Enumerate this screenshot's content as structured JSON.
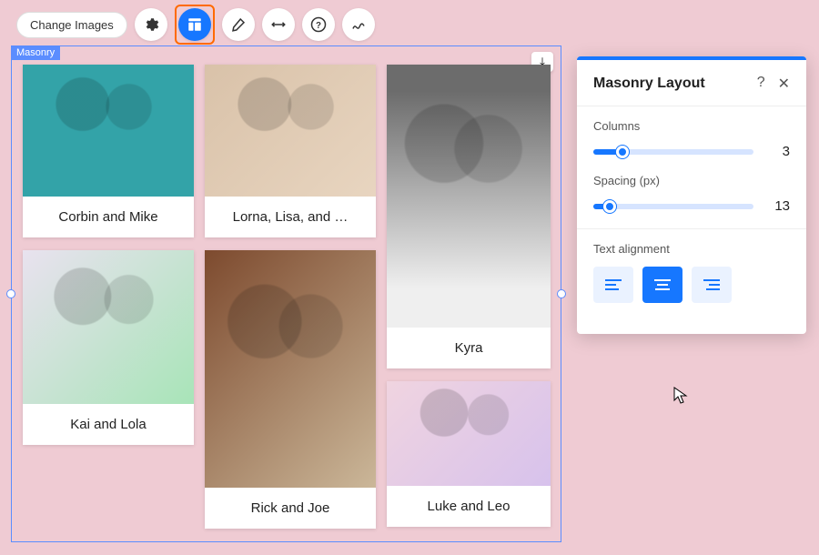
{
  "toolbar": {
    "change_images_label": "Change Images",
    "icons": [
      "gear-icon",
      "layout-icon",
      "brush-icon",
      "resize-icon",
      "help-icon",
      "animation-icon"
    ],
    "active_index": 1,
    "highlighted_index": 1
  },
  "gallery": {
    "tag_label": "Masonry",
    "download_glyph": "⤓",
    "cards": [
      {
        "caption": "Corbin and Mike"
      },
      {
        "caption": "Lorna, Lisa, and …"
      },
      {
        "caption": "Kyra"
      },
      {
        "caption": "Kai and Lola"
      },
      {
        "caption": "Rick and Joe"
      },
      {
        "caption": "Luke and Leo"
      }
    ]
  },
  "panel": {
    "title": "Masonry Layout",
    "help_glyph": "?",
    "close_glyph": "✕",
    "columns": {
      "label": "Columns",
      "value": "3",
      "fill_pct": "18%",
      "thumb_pct": "18%"
    },
    "spacing": {
      "label": "Spacing (px)",
      "value": "13",
      "fill_pct": "10%",
      "thumb_pct": "10%"
    },
    "alignment": {
      "label": "Text alignment",
      "options": [
        "left",
        "center",
        "right"
      ],
      "active_index": 1
    }
  }
}
